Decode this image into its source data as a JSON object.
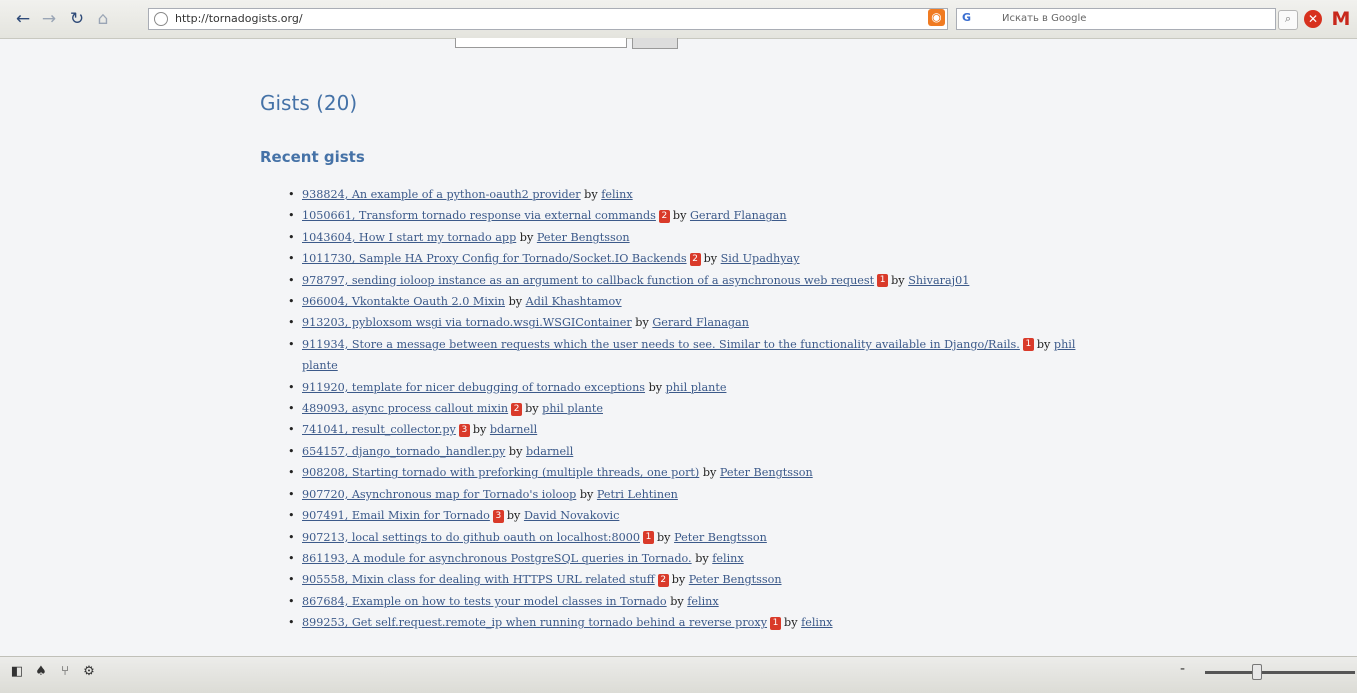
{
  "browser": {
    "url": "http://tornadogists.org/",
    "search_placeholder": "Искать в Google",
    "icons": {
      "back": "←",
      "forward": "→",
      "reload": "↻",
      "home": "⌂",
      "rss": "◉",
      "stop": "✕",
      "gmail": "M",
      "find": "⌕",
      "engine": "G"
    }
  },
  "page": {
    "gists_heading": "Gists (20)",
    "recent_heading": "Recent gists",
    "gists": [
      {
        "link": "938824, An example of a python-oauth2 provider",
        "badge": "",
        "by": "by",
        "author": "felinx"
      },
      {
        "link": "1050661, Transform tornado response via external commands",
        "badge": "2",
        "by": "by",
        "author": "Gerard Flanagan"
      },
      {
        "link": "1043604, How I start my tornado app",
        "badge": "",
        "by": "by",
        "author": "Peter Bengtsson"
      },
      {
        "link": "1011730, Sample HA Proxy Config for Tornado/Socket.IO Backends",
        "badge": "2",
        "by": "by",
        "author": "Sid Upadhyay"
      },
      {
        "link": "978797, sending ioloop instance as an argument to callback function of a asynchronous web request",
        "badge": "1",
        "by": "by",
        "author": "Shivaraj01"
      },
      {
        "link": "966004, Vkontakte Oauth 2.0 Mixin",
        "badge": "",
        "by": "by",
        "author": "Adil Khashtamov"
      },
      {
        "link": "913203, pybloxsom wsgi via tornado.wsgi.WSGIContainer",
        "badge": "",
        "by": "by",
        "author": "Gerard Flanagan"
      },
      {
        "link": "911934, Store a message between requests which the user needs to see. Similar to the functionality available in Django/Rails.",
        "badge": "1",
        "by": "by",
        "author": "phil plante"
      },
      {
        "link": "911920, template for nicer debugging of tornado exceptions",
        "badge": "",
        "by": "by",
        "author": "phil plante"
      },
      {
        "link": "489093, async process callout mixin",
        "badge": "2",
        "by": "by",
        "author": "phil plante"
      },
      {
        "link": "741041, result_collector.py",
        "badge": "3",
        "by": "by",
        "author": "bdarnell"
      },
      {
        "link": "654157, django_tornado_handler.py",
        "badge": "",
        "by": "by",
        "author": "bdarnell"
      },
      {
        "link": "908208, Starting tornado with preforking (multiple threads, one port)",
        "badge": "",
        "by": "by",
        "author": "Peter Bengtsson"
      },
      {
        "link": "907720, Asynchronous map for Tornado's ioloop",
        "badge": "",
        "by": "by",
        "author": "Petri Lehtinen"
      },
      {
        "link": "907491, Email Mixin for Tornado",
        "badge": "3",
        "by": "by",
        "author": "David Novakovic"
      },
      {
        "link": "907213, local settings to do github oauth on localhost:8000",
        "badge": "1",
        "by": "by",
        "author": "Peter Bengtsson"
      },
      {
        "link": "861193, A module for asynchronous PostgreSQL queries in Tornado.",
        "badge": "",
        "by": "by",
        "author": "felinx"
      },
      {
        "link": "905558, Mixin class for dealing with HTTPS URL related stuff",
        "badge": "2",
        "by": "by",
        "author": "Peter Bengtsson"
      },
      {
        "link": "867684, Example on how to tests your model classes in Tornado",
        "badge": "",
        "by": "by",
        "author": "felinx"
      },
      {
        "link": "899253, Get self.request.remote_ip when running tornado behind a reverse proxy",
        "badge": "1",
        "by": "by",
        "author": "felinx"
      }
    ]
  },
  "statusbar": {
    "icons": [
      "◧",
      "♠",
      "⑂",
      "⚙"
    ],
    "zoom_minus": "-"
  }
}
